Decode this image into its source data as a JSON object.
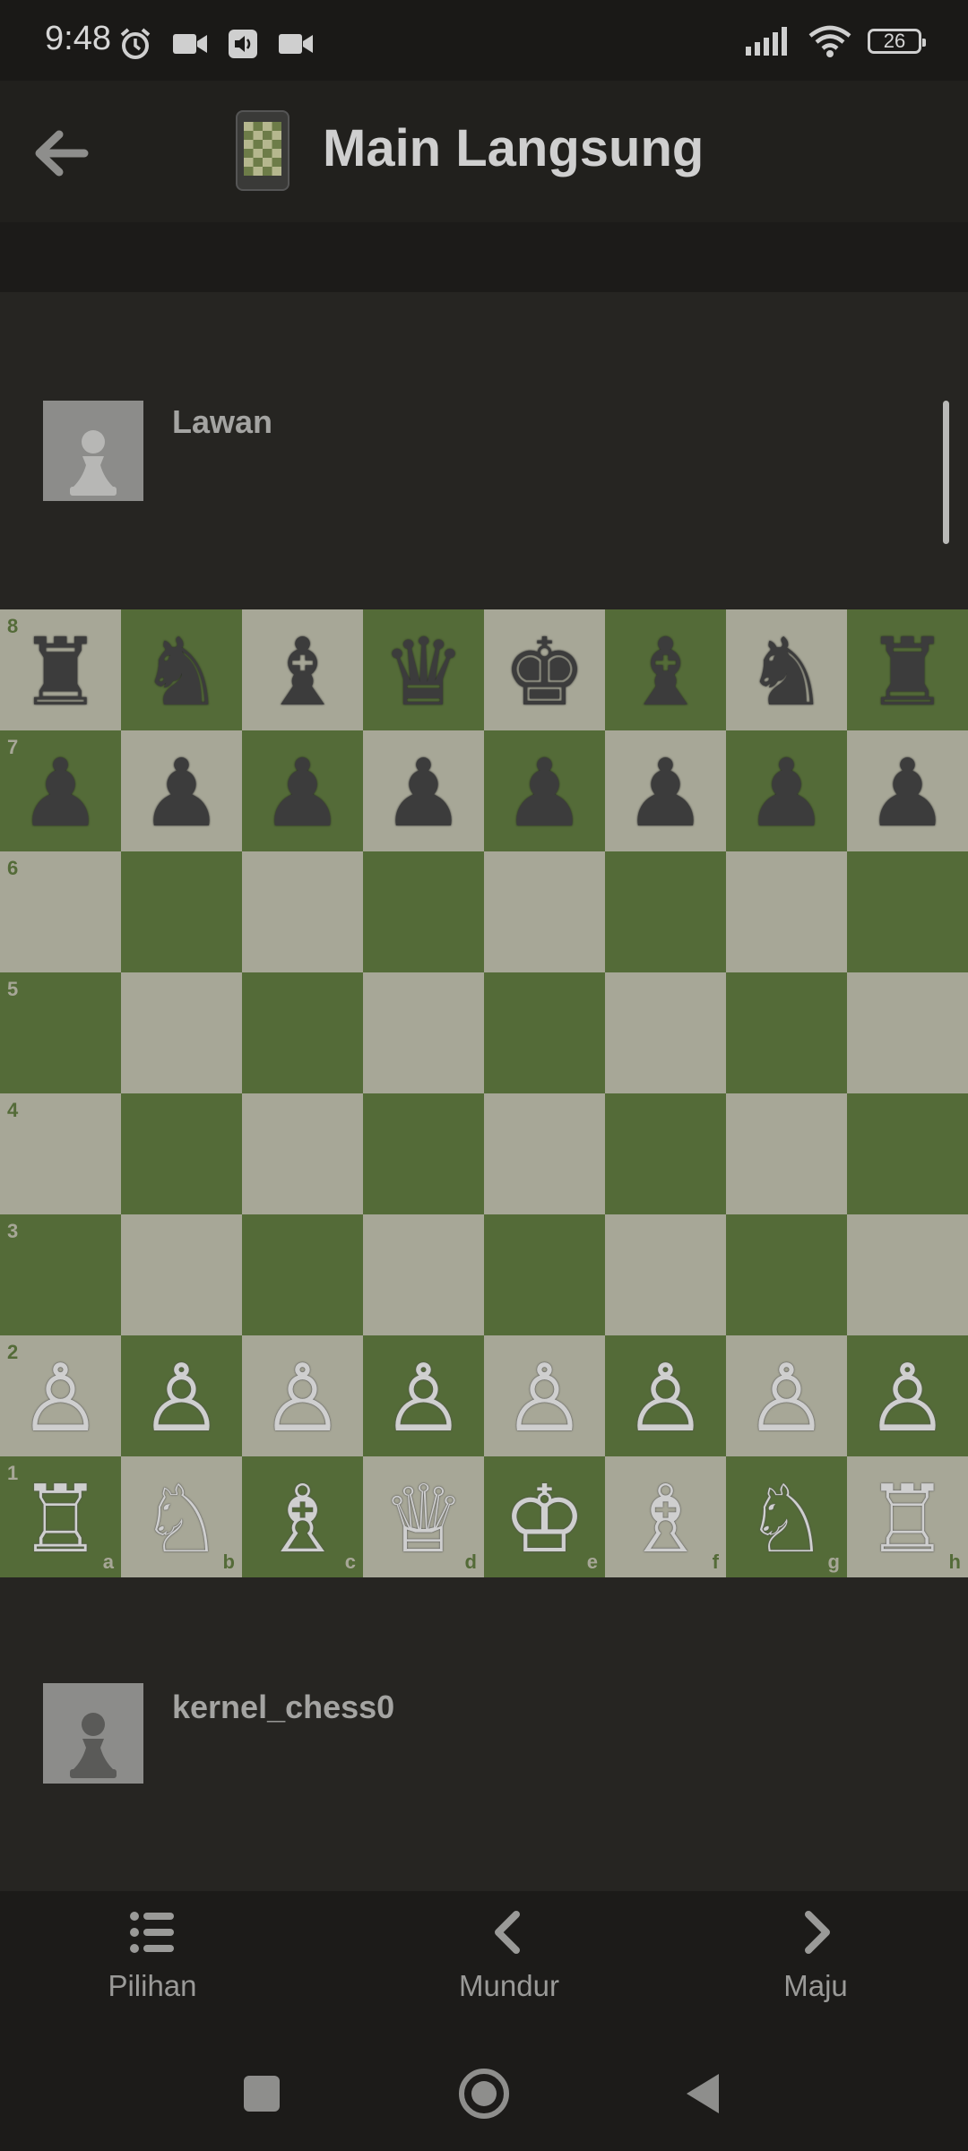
{
  "status_bar": {
    "time": "9:48",
    "battery": "26"
  },
  "header": {
    "title": "Main Langsung"
  },
  "players": {
    "opponent": {
      "name": "Lawan"
    },
    "self": {
      "name": "kernel_chess0"
    }
  },
  "board": {
    "ranks": [
      "8",
      "7",
      "6",
      "5",
      "4",
      "3",
      "2",
      "1"
    ],
    "files": [
      "a",
      "b",
      "c",
      "d",
      "e",
      "f",
      "g",
      "h"
    ],
    "position": [
      [
        "♜",
        "♞",
        "♝",
        "♛",
        "♚",
        "♝",
        "♞",
        "♜"
      ],
      [
        "♟",
        "♟",
        "♟",
        "♟",
        "♟",
        "♟",
        "♟",
        "♟"
      ],
      [
        "",
        "",
        "",
        "",
        "",
        "",
        "",
        ""
      ],
      [
        "",
        "",
        "",
        "",
        "",
        "",
        "",
        ""
      ],
      [
        "",
        "",
        "",
        "",
        "",
        "",
        "",
        ""
      ],
      [
        "",
        "",
        "",
        "",
        "",
        "",
        "",
        ""
      ],
      [
        "♙",
        "♙",
        "♙",
        "♙",
        "♙",
        "♙",
        "♙",
        "♙"
      ],
      [
        "♖",
        "♘",
        "♗",
        "♕",
        "♔",
        "♗",
        "♘",
        "♖"
      ]
    ]
  },
  "bottom_nav": {
    "options_label": "Pilihan",
    "back_label": "Mundur",
    "forward_label": "Maju"
  },
  "colors": {
    "light_square": "#a7a797",
    "dark_square": "#546b38",
    "background": "#262522"
  }
}
